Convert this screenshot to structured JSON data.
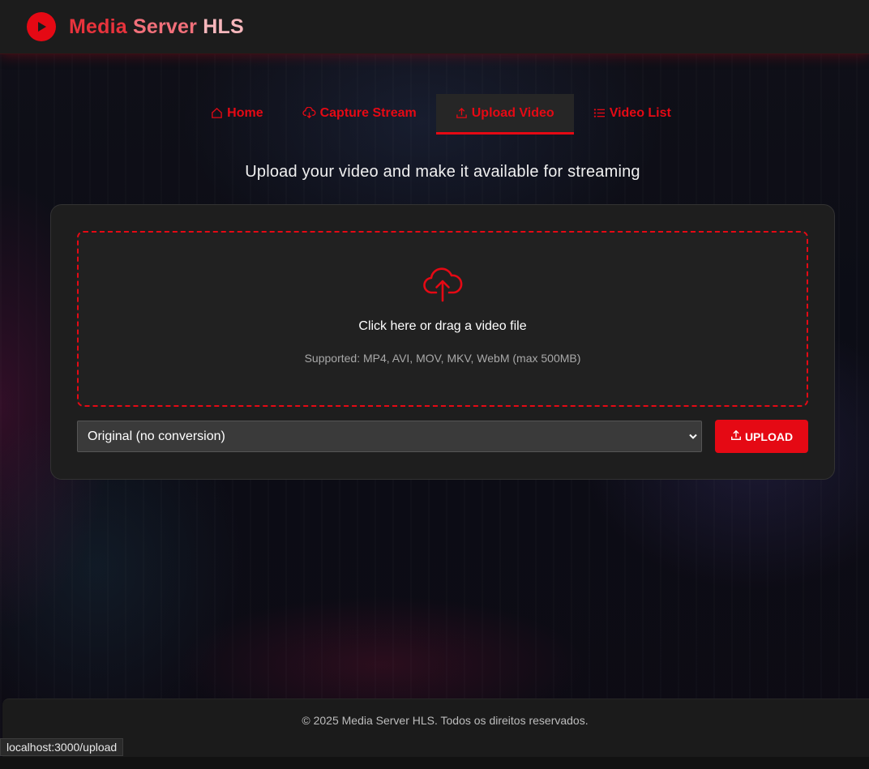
{
  "header": {
    "brand_part1": "Media",
    "brand_part2": "Server",
    "brand_part3": "HLS",
    "logo_icon": "play-circle-icon"
  },
  "nav": {
    "tabs": [
      {
        "label": "Home",
        "icon": "home-icon",
        "active": false
      },
      {
        "label": "Capture Stream",
        "icon": "cloud-download-icon",
        "active": false
      },
      {
        "label": "Upload Video",
        "icon": "upload-icon",
        "active": true
      },
      {
        "label": "Video List",
        "icon": "list-icon",
        "active": false
      }
    ]
  },
  "main": {
    "subtitle": "Upload your video and make it available for streaming",
    "dropzone": {
      "icon": "cloud-upload-icon",
      "text": "Click here or drag a video file",
      "hint": "Supported: MP4, AVI, MOV, MKV, WebM (max 500MB)"
    },
    "conversion_select": {
      "selected": "Original (no conversion)"
    },
    "upload_button": {
      "label": "UPLOAD",
      "icon": "upload-icon"
    }
  },
  "footer": {
    "text": "© 2025 Media Server HLS. Todos os direitos reservados."
  },
  "status_bar": {
    "url": "localhost:3000/upload"
  },
  "colors": {
    "accent": "#e50914",
    "background": "#0b0b0f",
    "card": "#1e1e1e"
  }
}
